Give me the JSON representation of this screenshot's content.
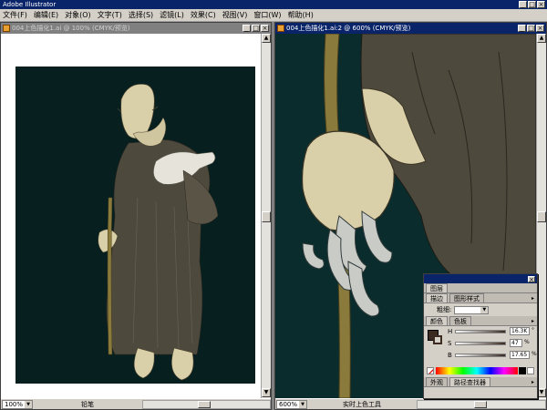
{
  "app": {
    "title": "Adobe Illustrator"
  },
  "menu": [
    "文件(F)",
    "编辑(E)",
    "对象(O)",
    "文字(T)",
    "选择(S)",
    "滤镜(L)",
    "效果(C)",
    "视图(V)",
    "窗口(W)",
    "帮助(H)"
  ],
  "window_buttons": {
    "minimize": "_",
    "maximize": "□",
    "close": "×"
  },
  "doc_left": {
    "title": "004上色描化1.ai @ 100% (CMYK/预览)",
    "zoom": "100%",
    "status": "铅笔",
    "colors": {
      "artboard": "#07201f",
      "pasteboard": "#ffffff"
    }
  },
  "doc_right": {
    "title": "004上色描化1.ai:2 @ 600% (CMYK/预览)",
    "zoom": "600%",
    "status": "实时上色工具",
    "colors": {
      "background": "#0b2c2c"
    }
  },
  "panel": {
    "layers_tab": "图层",
    "stroke_tab": "描边",
    "graphic_styles_tab": "图形样式",
    "weight_label": "粗细:",
    "color_tab": "颜色",
    "swatches_tab": "色板",
    "h_label": "H",
    "h_value": "16.3K",
    "s_label": "S",
    "s_value": "47",
    "b_label": "B",
    "b_value": "17.65",
    "percent": "%",
    "degree": "°",
    "appearance_tab": "外观",
    "pathfinder_tab": "路径查找器",
    "fill_color": "#3a2a20"
  }
}
